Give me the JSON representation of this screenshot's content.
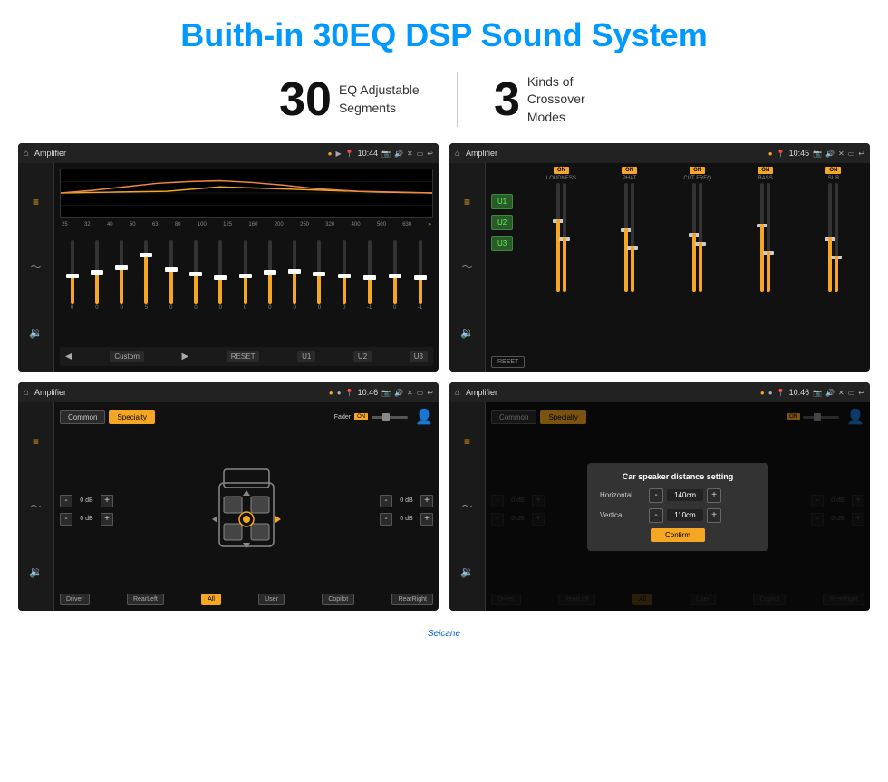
{
  "page": {
    "title": "Buith-in 30EQ DSP Sound System",
    "stat1_number": "30",
    "stat1_label": "EQ Adjustable Segments",
    "stat2_number": "3",
    "stat2_label": "Kinds of Crossover Modes"
  },
  "screen1": {
    "title": "Amplifier",
    "time": "10:44",
    "custom_label": "Custom",
    "reset_label": "RESET",
    "u1_label": "U1",
    "u2_label": "U2",
    "u3_label": "U3",
    "freqs": [
      "25",
      "32",
      "40",
      "50",
      "63",
      "80",
      "100",
      "125",
      "160",
      "200",
      "250",
      "320",
      "400",
      "500",
      "630"
    ],
    "vals": [
      "0",
      "0",
      "0",
      "5",
      "0",
      "0",
      "0",
      "0",
      "0",
      "0",
      "0",
      "0",
      "-1",
      "0",
      "-1"
    ]
  },
  "screen2": {
    "title": "Amplifier",
    "time": "10:45",
    "u1": "U1",
    "u2": "U2",
    "u3": "U3",
    "reset_label": "RESET",
    "channels": [
      {
        "label": "LOUDNESS",
        "on": true
      },
      {
        "label": "PHAT",
        "on": true
      },
      {
        "label": "CUT FREQ",
        "on": true
      },
      {
        "label": "BASS",
        "on": true
      },
      {
        "label": "SUB",
        "on": true
      }
    ]
  },
  "screen3": {
    "title": "Amplifier",
    "time": "10:46",
    "tab_common": "Common",
    "tab_specialty": "Specialty",
    "fader_label": "Fader",
    "on_label": "ON",
    "db_values": [
      "0 dB",
      "0 dB",
      "0 dB",
      "0 dB"
    ],
    "btns": [
      "Driver",
      "RearLeft",
      "All",
      "User",
      "Copilot",
      "RearRight"
    ]
  },
  "screen4": {
    "title": "Amplifier",
    "time": "10:46",
    "tab_common": "Common",
    "tab_specialty": "Specialty",
    "on_label": "ON",
    "btns": [
      "Driver",
      "RearLeft",
      "All",
      "User",
      "Copilot",
      "RearRight"
    ],
    "modal": {
      "title": "Car speaker distance setting",
      "horiz_label": "Horizontal",
      "horiz_val": "140cm",
      "vert_label": "Vertical",
      "vert_val": "110cm",
      "confirm_label": "Confirm",
      "db_right_top": "0 dB",
      "db_right_bot": "0 dB"
    }
  },
  "watermark": "Seicane"
}
